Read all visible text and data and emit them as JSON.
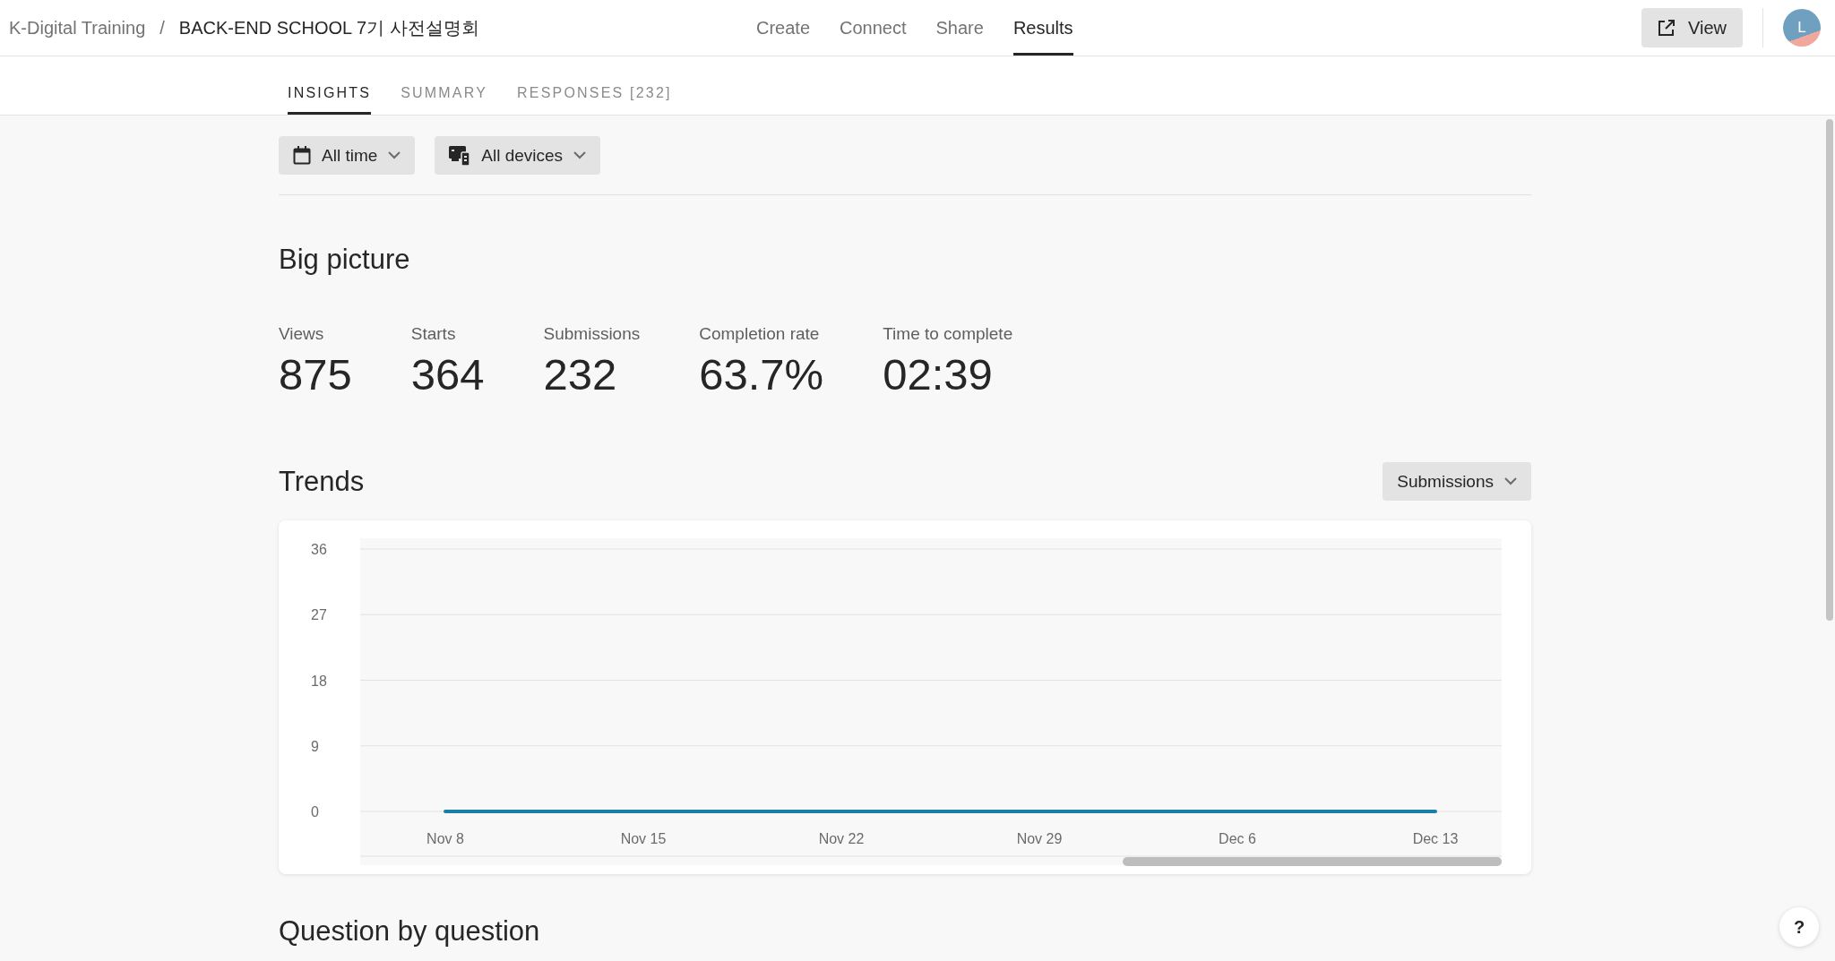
{
  "breadcrumb": {
    "workspace": "K-Digital Training",
    "separator": "/",
    "form": "BACK-END SCHOOL 7기 사전설명회"
  },
  "nav": [
    {
      "label": "Create",
      "selected": false
    },
    {
      "label": "Connect",
      "selected": false
    },
    {
      "label": "Share",
      "selected": false
    },
    {
      "label": "Results",
      "selected": true
    }
  ],
  "view_button": "View",
  "avatar": "L",
  "tabs": [
    {
      "label": "INSIGHTS",
      "selected": true
    },
    {
      "label": "SUMMARY",
      "selected": false
    },
    {
      "label": "RESPONSES [232]",
      "selected": false
    }
  ],
  "filters": [
    {
      "kind": "calendar",
      "label": "All time"
    },
    {
      "kind": "devices",
      "label": "All devices"
    }
  ],
  "big_picture": {
    "title": "Big picture",
    "stats": [
      {
        "label": "Views",
        "value": "875"
      },
      {
        "label": "Starts",
        "value": "364"
      },
      {
        "label": "Submissions",
        "value": "232"
      },
      {
        "label": "Completion rate",
        "value": "63.7%"
      },
      {
        "label": "Time to complete",
        "value": "02:39"
      }
    ]
  },
  "trends": {
    "title": "Trends",
    "metric": "Submissions",
    "chart_data": {
      "type": "line",
      "categories": [
        "Nov 8",
        "Nov 15",
        "Nov 22",
        "Nov 29",
        "Dec 6",
        "Dec 13"
      ],
      "ylim": [
        0,
        36
      ],
      "grid": true,
      "yticks": [
        0,
        9,
        18,
        27,
        36
      ],
      "series": [
        {
          "color": "#1a7fa6",
          "values": [
            0,
            0,
            0,
            0,
            0,
            0
          ]
        }
      ]
    }
  },
  "next_section": "Question by question",
  "help": "?"
}
